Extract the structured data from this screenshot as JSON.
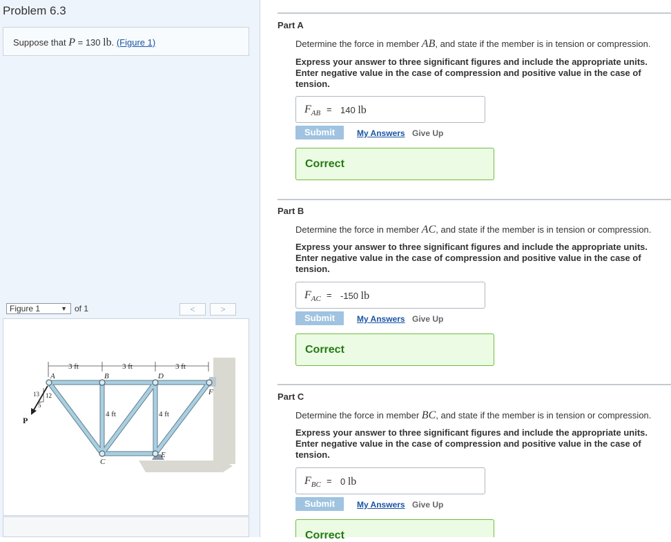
{
  "problem": {
    "title": "Problem 6.3",
    "statement_prefix": "Suppose that ",
    "variable": "P",
    "equals": " = 130 ",
    "unit": "lb",
    "period": ". ",
    "figure_link": "(Figure 1)"
  },
  "figure_nav": {
    "select_value": "Figure 1",
    "of_label": "of 1",
    "prev": "<",
    "next": ">"
  },
  "figure": {
    "dim_labels": [
      "3 ft",
      "3 ft",
      "3 ft"
    ],
    "height_labels": [
      "4 ft",
      "4 ft"
    ],
    "joints": [
      "A",
      "B",
      "C",
      "D",
      "E",
      "F"
    ],
    "slope": [
      "13",
      "12",
      "5"
    ],
    "load": "P"
  },
  "parts": [
    {
      "title": "Part A",
      "q_prefix": "Determine the force in member ",
      "member": "AB",
      "q_suffix": ", and state if the member is in tension or compression.",
      "instructions": "Express your answer to three significant figures and include the appropriate units. Enter negative value in the case of compression and positive value in the case of tension.",
      "answer_var": "F",
      "answer_sub": "AB",
      "answer_eq": "=",
      "answer_value": "140",
      "answer_unit": "lb",
      "submit": "Submit",
      "my_answers": "My Answers",
      "give_up": "Give Up",
      "feedback": "Correct"
    },
    {
      "title": "Part B",
      "q_prefix": "Determine the force in member ",
      "member": "AC",
      "q_suffix": ", and state if the member is in tension or compression.",
      "instructions": "Express your answer to three significant figures and include the appropriate units. Enter negative value in the case of compression and positive value in the case of tension.",
      "answer_var": "F",
      "answer_sub": "AC",
      "answer_eq": "=",
      "answer_value": "-150",
      "answer_unit": "lb",
      "submit": "Submit",
      "my_answers": "My Answers",
      "give_up": "Give Up",
      "feedback": "Correct"
    },
    {
      "title": "Part C",
      "q_prefix": "Determine the force in member ",
      "member": "BC",
      "q_suffix": ", and state if the member is in tension or compression.",
      "instructions": "Express your answer to three significant figures and include the appropriate units. Enter negative value in the case of compression and positive value in the case of tension.",
      "answer_var": "F",
      "answer_sub": "BC",
      "answer_eq": "=",
      "answer_value": "0",
      "answer_unit": "lb",
      "submit": "Submit",
      "my_answers": "My Answers",
      "give_up": "Give Up",
      "feedback": "Correct"
    }
  ],
  "colors": {
    "submit_bg": "#9fc3e0",
    "link": "#1a53a3",
    "correct_bg": "#ecfbe3",
    "correct_border": "#6fbb3f",
    "correct_text": "#237a12",
    "truss_member": "#a9cfe0"
  }
}
